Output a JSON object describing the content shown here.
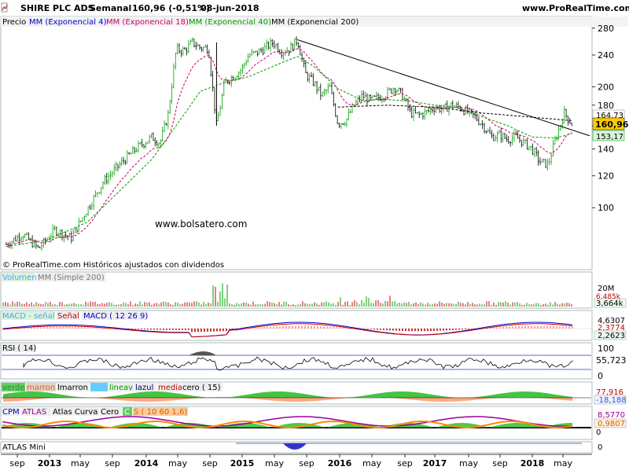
{
  "header": {
    "instrument": "SHIRE PLC ADS",
    "period": "Semanal",
    "last_change": "160,96 (-0,51%)",
    "date": "08-jun-2018",
    "site": "www.ProRealTime.com"
  },
  "colors": {
    "price_up": "#00a000",
    "price_down": "#000000",
    "ema4": "#ff0000",
    "ema18": "#cc0066",
    "ema40": "#009900",
    "ema200": "#000000",
    "volume": "#cc0000",
    "macd": "#0000cc",
    "signal": "#cc0000",
    "rsi": "#000000",
    "green_fill": "#22bb22",
    "orange_fill": "#ff9966",
    "purple": "#990099",
    "accent_price_label": "#ffcc00"
  },
  "main_panel": {
    "legend": [
      "Precio",
      "MM (Exponencial 4)",
      "MM (Exponencial 18)",
      "MM (Exponencial 40)",
      "MM (Exponencial 200)"
    ],
    "watermark": "www.bolsatero.com",
    "footnote": "© ProRealTime.com  Históricos ajustados con dividendos",
    "price_labels": {
      "ema200": "164,73",
      "last": "160,96",
      "ema40": "153,17"
    }
  },
  "volume_panel": {
    "legend": [
      "Volumen",
      "MM (Simple 200)"
    ],
    "axis_labels": [
      "20M"
    ],
    "value_labels": [
      "6,485k",
      "3,664k"
    ]
  },
  "macd_panel": {
    "legend": [
      "MACD - señal",
      "Señal",
      "MACD ( 12 26 9)"
    ],
    "value_labels": [
      "4,6307",
      "2,3774",
      "2,2623"
    ]
  },
  "rsi_panel": {
    "legend": [
      "RSI ( 14)"
    ],
    "axis_labels": [
      "100",
      "0"
    ],
    "value_label": "55,723"
  },
  "atlas_lines_panel": {
    "legend": [
      "verde",
      "marron",
      "lmarron",
      "lverde",
      "lineav",
      "lazul",
      "media",
      "cero ( 15)"
    ],
    "value_labels": [
      "77,916",
      "-18,188"
    ]
  },
  "atlas_curve_panel": {
    "legend": [
      "CPM",
      "ATLAS",
      "Atlas Curva",
      "Cero",
      "C",
      "S ( 10 60 1,6)"
    ],
    "value_labels": [
      "8,5770",
      "0,9807",
      "0"
    ]
  },
  "atlas_mini_panel": {
    "legend": [
      "ATLAS Mini"
    ],
    "value_label": "0"
  },
  "x_axis": {
    "ticks": [
      {
        "label": "sep",
        "bold": false
      },
      {
        "label": "2013",
        "bold": true
      },
      {
        "label": "may",
        "bold": false
      },
      {
        "label": "sep",
        "bold": false
      },
      {
        "label": "2014",
        "bold": true
      },
      {
        "label": "may",
        "bold": false
      },
      {
        "label": "sep",
        "bold": false
      },
      {
        "label": "2015",
        "bold": true
      },
      {
        "label": "may",
        "bold": false
      },
      {
        "label": "sep",
        "bold": false
      },
      {
        "label": "2016",
        "bold": true
      },
      {
        "label": "may",
        "bold": false
      },
      {
        "label": "sep",
        "bold": false
      },
      {
        "label": "2017",
        "bold": true
      },
      {
        "label": "may",
        "bold": false
      },
      {
        "label": "sep",
        "bold": false
      },
      {
        "label": "2018",
        "bold": true
      },
      {
        "label": "may",
        "bold": false
      }
    ]
  },
  "chart_data": {
    "type": "line",
    "title": "SHIRE PLC ADS",
    "subtitle": "Semanal",
    "y_scale": "log",
    "ylim": [
      75,
      290
    ],
    "y_ticks": [
      100,
      120,
      140,
      160,
      180,
      200,
      240,
      280
    ],
    "grid": false,
    "legend": "top-left",
    "x_start": "2012-08",
    "x_end": "2018-06",
    "series": [
      {
        "name": "Precio",
        "points": [
          [
            "2012-08",
            81
          ],
          [
            "2012-10",
            86
          ],
          [
            "2012-12",
            79
          ],
          [
            "2013-02",
            88
          ],
          [
            "2013-04",
            84
          ],
          [
            "2013-06",
            99
          ],
          [
            "2013-08",
            116
          ],
          [
            "2013-10",
            128
          ],
          [
            "2013-12",
            140
          ],
          [
            "2014-02",
            150
          ],
          [
            "2014-03",
            145
          ],
          [
            "2014-04",
            170
          ],
          [
            "2014-05",
            248
          ],
          [
            "2014-06",
            246
          ],
          [
            "2014-07",
            258
          ],
          [
            "2014-08",
            250
          ],
          [
            "2014-09",
            250
          ],
          [
            "2014-10",
            160
          ],
          [
            "2014-11",
            205
          ],
          [
            "2014-12",
            212
          ],
          [
            "2015-01",
            220
          ],
          [
            "2015-02",
            240
          ],
          [
            "2015-03",
            243
          ],
          [
            "2015-04",
            250
          ],
          [
            "2015-05",
            258
          ],
          [
            "2015-06",
            245
          ],
          [
            "2015-07",
            248
          ],
          [
            "2015-08",
            262
          ],
          [
            "2015-09",
            215
          ],
          [
            "2015-10",
            205
          ],
          [
            "2015-11",
            190
          ],
          [
            "2015-12",
            200
          ],
          [
            "2016-01",
            162
          ],
          [
            "2016-02",
            165
          ],
          [
            "2016-03",
            180
          ],
          [
            "2016-04",
            190
          ],
          [
            "2016-05",
            185
          ],
          [
            "2016-06",
            188
          ],
          [
            "2016-07",
            192
          ],
          [
            "2016-08",
            200
          ],
          [
            "2016-09",
            190
          ],
          [
            "2016-10",
            172
          ],
          [
            "2016-11",
            170
          ],
          [
            "2016-12",
            173
          ],
          [
            "2017-01",
            178
          ],
          [
            "2017-02",
            176
          ],
          [
            "2017-03",
            180
          ],
          [
            "2017-04",
            178
          ],
          [
            "2017-05",
            173
          ],
          [
            "2017-06",
            168
          ],
          [
            "2017-07",
            160
          ],
          [
            "2017-08",
            150
          ],
          [
            "2017-09",
            152
          ],
          [
            "2017-10",
            148
          ],
          [
            "2017-11",
            150
          ],
          [
            "2017-12",
            145
          ],
          [
            "2018-01",
            140
          ],
          [
            "2018-02",
            130
          ],
          [
            "2018-03",
            128
          ],
          [
            "2018-04",
            150
          ],
          [
            "2018-05",
            172
          ],
          [
            "2018-06",
            160.96
          ]
        ]
      },
      {
        "name": "MM (Exponencial 40)",
        "points": [
          [
            "2012-08",
            80
          ],
          [
            "2013-01",
            83
          ],
          [
            "2013-06",
            92
          ],
          [
            "2013-10",
            110
          ],
          [
            "2014-02",
            132
          ],
          [
            "2014-05",
            160
          ],
          [
            "2014-08",
            195
          ],
          [
            "2014-11",
            205
          ],
          [
            "2015-02",
            212
          ],
          [
            "2015-05",
            225
          ],
          [
            "2015-08",
            238
          ],
          [
            "2015-10",
            225
          ],
          [
            "2016-01",
            198
          ],
          [
            "2016-04",
            185
          ],
          [
            "2016-07",
            186
          ],
          [
            "2016-10",
            184
          ],
          [
            "2017-01",
            180
          ],
          [
            "2017-04",
            177
          ],
          [
            "2017-07",
            168
          ],
          [
            "2017-10",
            160
          ],
          [
            "2018-01",
            150
          ],
          [
            "2018-04",
            149
          ],
          [
            "2018-06",
            153.17
          ]
        ]
      },
      {
        "name": "MM (Exponencial 200)",
        "points": [
          [
            "2016-01",
            178
          ],
          [
            "2016-07",
            180
          ],
          [
            "2017-01",
            178
          ],
          [
            "2017-07",
            172
          ],
          [
            "2018-01",
            168
          ],
          [
            "2018-06",
            164.73
          ]
        ]
      }
    ],
    "trendlines": [
      {
        "from": [
          "2015-08",
          262
        ],
        "to": [
          "2018-06",
          158
        ]
      }
    ]
  }
}
